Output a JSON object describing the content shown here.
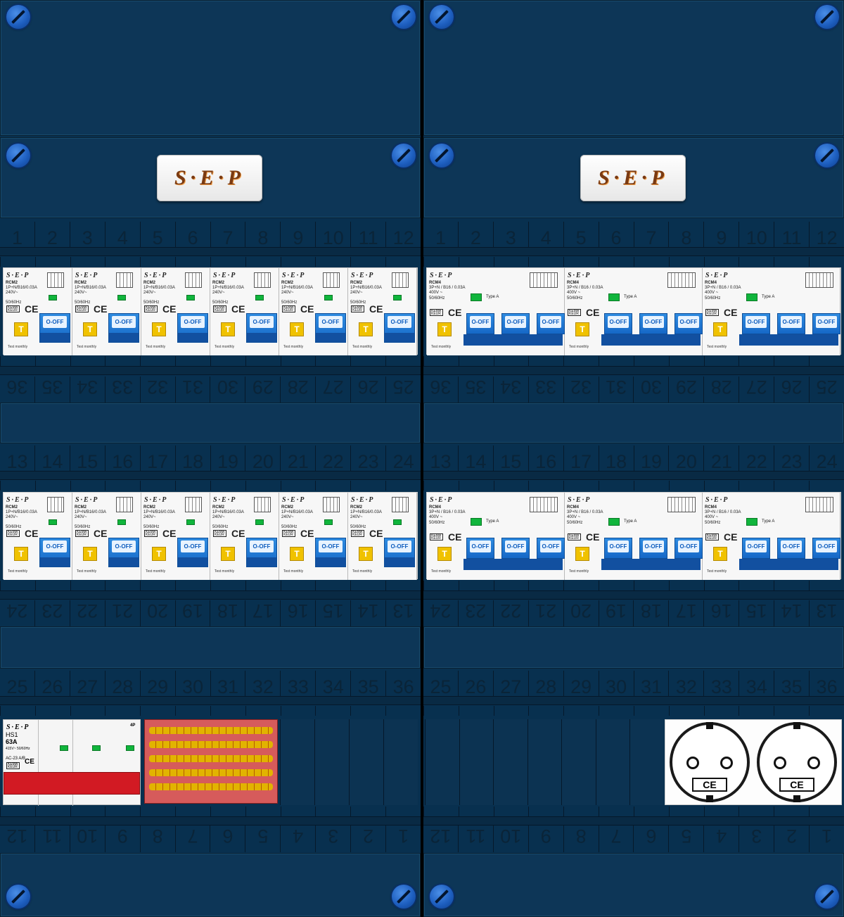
{
  "logo_text": "S·E·P",
  "number_strips": {
    "row1_top": [
      "1",
      "2",
      "3",
      "4",
      "5",
      "6",
      "7",
      "8",
      "9",
      "10",
      "11",
      "12"
    ],
    "row1_bottom": [
      "25",
      "26",
      "27",
      "28",
      "29",
      "30",
      "31",
      "32",
      "33",
      "34",
      "35",
      "36"
    ],
    "row2_top": [
      "13",
      "14",
      "15",
      "16",
      "17",
      "18",
      "19",
      "20",
      "21",
      "22",
      "23",
      "24"
    ],
    "row2_bottom": [
      "13",
      "14",
      "15",
      "16",
      "17",
      "18",
      "19",
      "20",
      "21",
      "22",
      "23",
      "24"
    ],
    "row3_top": [
      "25",
      "26",
      "27",
      "28",
      "29",
      "30",
      "31",
      "32",
      "33",
      "34",
      "35",
      "36"
    ],
    "row3_bottom": [
      "1",
      "2",
      "3",
      "4",
      "5",
      "6",
      "7",
      "8",
      "9",
      "10",
      "11",
      "12"
    ]
  },
  "rcm2": {
    "brand": "S·E·P",
    "model": "RCM2",
    "rating": "1P+N/B16/0.03A",
    "voltage": "240V~",
    "freq": "50/60Hz",
    "kema": "KEMA KEUR",
    "ce": "CE",
    "test_button": "T",
    "off_label": "O-OFF",
    "test_note": "Test monthly"
  },
  "rcm4": {
    "brand": "S·E·P",
    "model": "RCM4",
    "rating": "3P+N / B16 / 0.03A",
    "voltage": "400V ~",
    "freq": "50/60Hz",
    "kema": "KEMA KEUR",
    "ce": "CE",
    "type": "Type A",
    "test_button": "T",
    "off_label": "O-OFF",
    "test_note": "Test monthly"
  },
  "hs1": {
    "brand": "S·E·P",
    "model": "HS1",
    "rating": "63A",
    "poles": "4P",
    "voltage": "415V~ 50/60Hz",
    "ac": "AC-23 A/B",
    "kema": "KEMA KEUR",
    "ce": "CE"
  },
  "socket": {
    "ce": "CE"
  },
  "colors": {
    "panel": "#0d3657",
    "screw": "#1e5fc0",
    "off_button": "#1668c7",
    "test_button": "#f0c200",
    "main_switch": "#d21a23"
  }
}
